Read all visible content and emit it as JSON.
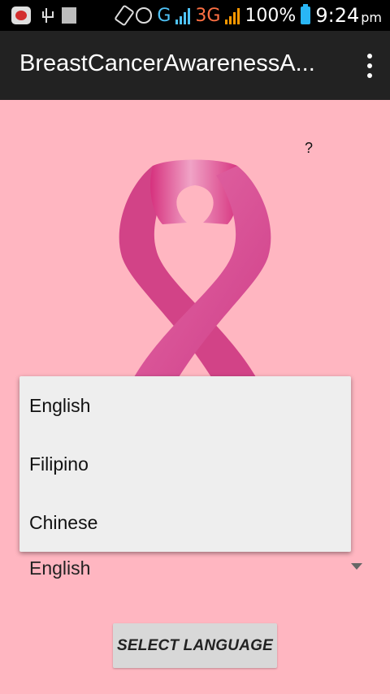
{
  "status_bar": {
    "network_g": "G",
    "network_3g": "3G",
    "battery_percent": "100%",
    "time": "9:24",
    "ampm": "pm",
    "icons": [
      "notification-app-icon",
      "usb-icon",
      "sd-card-icon",
      "vibrate-icon",
      "alarm-icon",
      "signal-icon",
      "signal-3g-icon",
      "battery-icon"
    ]
  },
  "action_bar": {
    "title": "BreastCancerAwarenessA...",
    "overflow_icon": "overflow-menu-icon"
  },
  "content": {
    "help_mark": "?",
    "ribbon_image": "pink-ribbon-image"
  },
  "language_spinner": {
    "selected": "English",
    "options": [
      "English",
      "Filipino",
      "Chinese"
    ]
  },
  "select_button": {
    "label": "SELECT LANGUAGE"
  },
  "colors": {
    "background": "#ffb6c1",
    "action_bar": "#222222",
    "popup": "#eeeeee",
    "button": "#d8d8d8"
  }
}
